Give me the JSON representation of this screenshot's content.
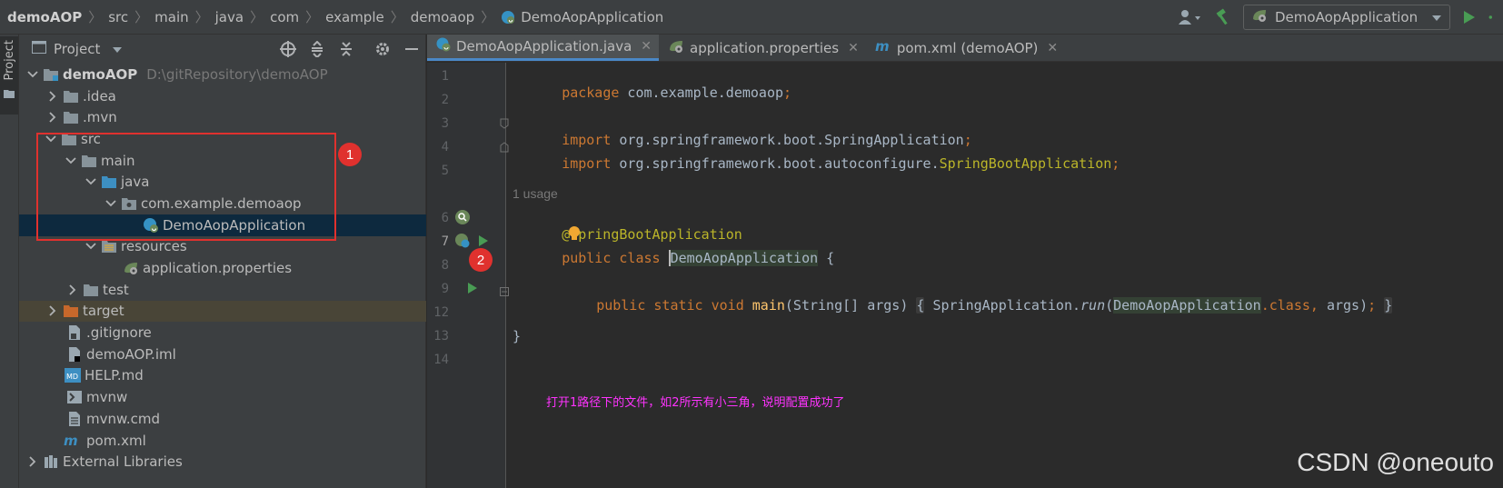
{
  "breadcrumb": {
    "items": [
      "demoAOP",
      "src",
      "main",
      "java",
      "com",
      "example",
      "demoaop",
      "DemoAopApplication"
    ]
  },
  "toolbar": {
    "run_config_label": "DemoAopApplication"
  },
  "stripe": {
    "label": "Project"
  },
  "project_panel": {
    "title": "Project",
    "tree": [
      {
        "label": "demoAOP",
        "path": "D:\\gitRepository\\demoAOP",
        "icon": "module-folder-icon",
        "expanded": true
      },
      {
        "label": ".idea",
        "icon": "folder-icon",
        "expanded": false
      },
      {
        "label": ".mvn",
        "icon": "folder-icon",
        "expanded": false
      },
      {
        "label": "src",
        "icon": "folder-icon",
        "expanded": true
      },
      {
        "label": "main",
        "icon": "folder-icon",
        "expanded": true
      },
      {
        "label": "java",
        "icon": "source-folder-icon",
        "expanded": true
      },
      {
        "label": "com.example.demoaop",
        "icon": "package-icon",
        "expanded": true
      },
      {
        "label": "DemoAopApplication",
        "icon": "spring-boot-class-icon",
        "selected": true
      },
      {
        "label": "resources",
        "icon": "resources-folder-icon",
        "expanded": true
      },
      {
        "label": "application.properties",
        "icon": "spring-properties-icon"
      },
      {
        "label": "test",
        "icon": "folder-icon",
        "expanded": false
      },
      {
        "label": "target",
        "icon": "excluded-folder-icon",
        "expanded": false
      },
      {
        "label": ".gitignore",
        "icon": "gitignore-file-icon"
      },
      {
        "label": "demoAOP.iml",
        "icon": "iml-file-icon"
      },
      {
        "label": "HELP.md",
        "icon": "markdown-file-icon"
      },
      {
        "label": "mvnw",
        "icon": "shell-file-icon"
      },
      {
        "label": "mvnw.cmd",
        "icon": "text-file-icon"
      },
      {
        "label": "pom.xml",
        "icon": "maven-file-icon"
      },
      {
        "label": "External Libraries",
        "icon": "libraries-icon",
        "expanded": false
      }
    ]
  },
  "editor": {
    "tabs": [
      {
        "label": "DemoAopApplication.java",
        "active": true
      },
      {
        "label": "application.properties",
        "active": false
      },
      {
        "label": "pom.xml (demoAOP)",
        "active": false
      }
    ],
    "line_numbers": [
      "1",
      "2",
      "3",
      "4",
      "5",
      "6",
      "7",
      "8",
      "9",
      "12",
      "13",
      "14"
    ],
    "usage_hint": "1 usage",
    "code": {
      "l1_kw": "package",
      "l1_rest": " com.example.demoaop",
      "l1_semi": ";",
      "l3_kw": "import",
      "l3_rest": " org.springframework.boot.SpringApplication",
      "l3_semi": ";",
      "l4_kw": "import",
      "l4_rest": " org.springframework.boot.autoconfigure.",
      "l4_ann": "SpringBootApplication",
      "l4_semi": ";",
      "l6_at": "@",
      "l6_rest": "pringBootApplication",
      "l7_kw": "public class ",
      "l7_name": "DemoAopApplication",
      "l7_rest": " {",
      "l9_kw": "public static void ",
      "l9_fn": "main",
      "l9_args": "(String[] args)",
      "l9_open": "{",
      "l9_call": " SpringApplication.",
      "l9_run": "run",
      "l9_paren": "(",
      "l9_cls": "DemoAopApplication",
      "l9_dotclass": ".class",
      "l9_comma": ", ",
      "l9_args2": "args)",
      "l9_semi": ";",
      "l9_close": "}",
      "l13": "}"
    }
  },
  "annotations": {
    "badge1": "1",
    "badge2": "2",
    "note": "打开1路径下的文件，如2所示有小三角，说明配置成功了"
  },
  "watermark": "CSDN @oneouto",
  "colors": {
    "accent": "#4a88c7",
    "annotation_red": "#e0312e",
    "note_magenta": "#ff33ff"
  }
}
